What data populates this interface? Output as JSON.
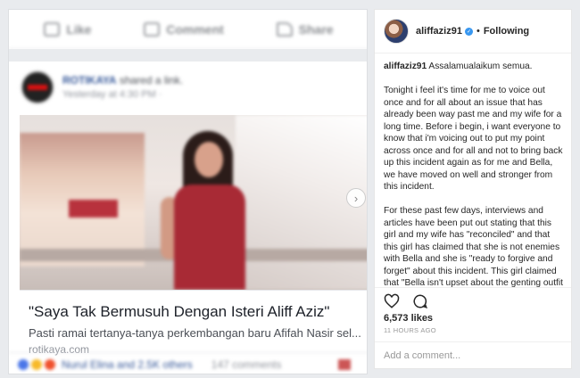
{
  "fb": {
    "actions": [
      {
        "label": "Like",
        "icon": "thumbs-up-icon"
      },
      {
        "label": "Comment",
        "icon": "comment-icon"
      },
      {
        "label": "Share",
        "icon": "share-icon"
      }
    ],
    "poster_name": "ROTIKAYA",
    "poster_action": "shared a link.",
    "post_time": "Yesterday at 4:30 PM ·",
    "link_title": "\"Saya Tak Bermusuh Dengan Isteri Aliff Aziz\"",
    "link_desc": "Pasti ramai tertanya-tanya perkembangan baru Afifah Nasir sel...",
    "link_domain": "rotikaya.com",
    "reaction_names": "Nurul Elina and 2.5K others",
    "comment_count": "147 comments"
  },
  "ig": {
    "username": "aliffaziz91",
    "follow_label": "Following",
    "caption": [
      "Assalamualaikum semua.",
      "Tonight i feel it's time for me to voice out once and for all about an issue that has already been way past me and my wife for a long time. Before i begin, i want everyone to know that i'm voicing out to put my point across once and for all and not to bring back up this incident again as for me and Bella, we have moved on well and stronger from this incident.",
      "For these past few days, interviews and articles have been put out stating that this girl and my wife has \"reconciled\" and that this girl has claimed that she is not enemies with Bella and she is \"ready to forgive and forget\" about this incident. This girl claimed that \"Bella isn't upset about the genting outfit issue as she has"
    ],
    "likes": "6,573 likes",
    "time": "11 HOURS AGO",
    "comment_placeholder": "Add a comment...",
    "accent": "#3897f0"
  }
}
